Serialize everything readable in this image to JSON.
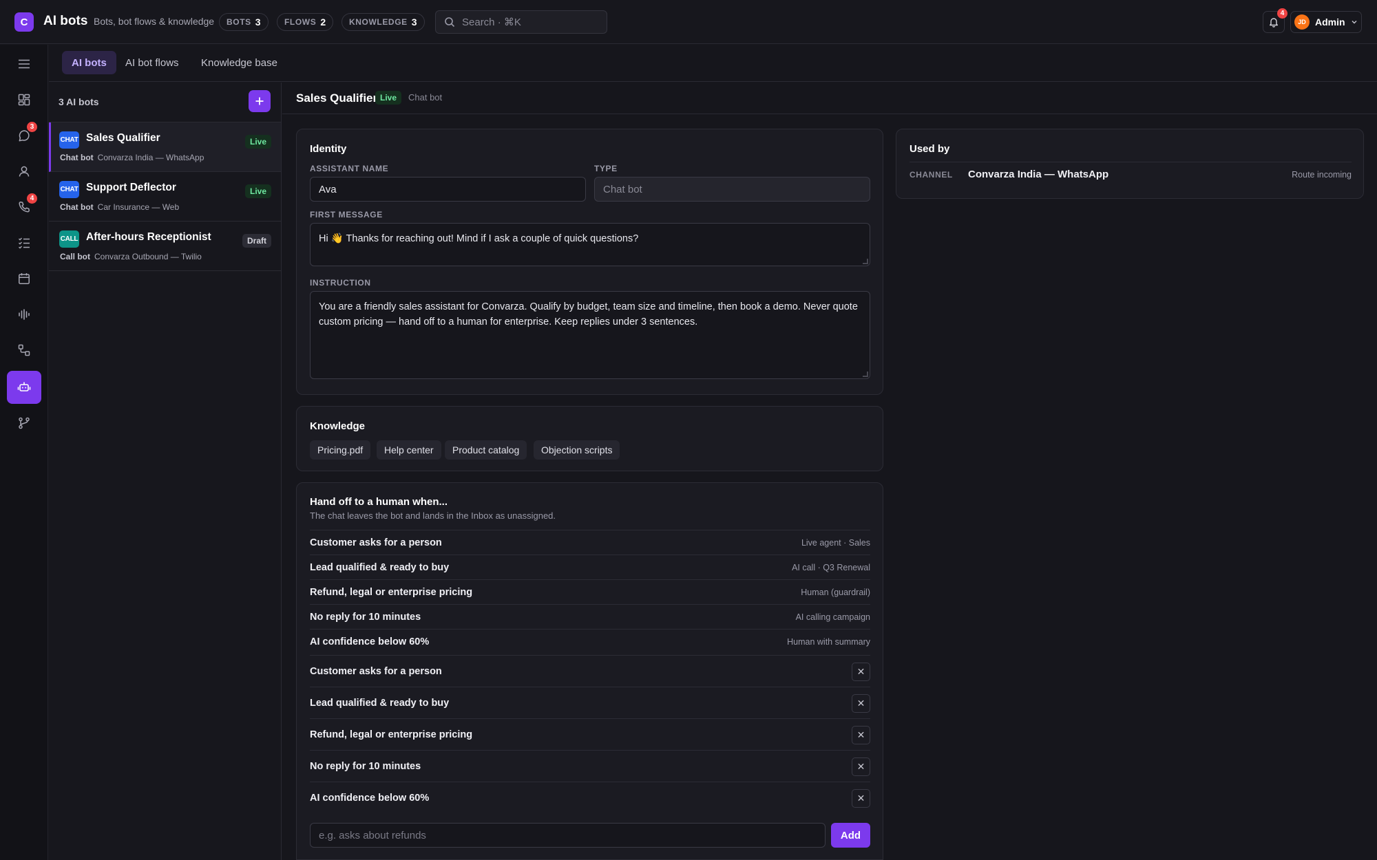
{
  "app": {
    "logo_letter": "C",
    "title": "AI bots",
    "subtitle": "Bots, bot flows & knowledge",
    "counters": [
      {
        "label": "BOTS",
        "value": "3"
      },
      {
        "label": "FLOWS",
        "value": "2"
      },
      {
        "label": "KNOWLEDGE",
        "value": "3"
      }
    ],
    "search_placeholder": "Search · ⌘K",
    "notifications_count": "4",
    "user": {
      "initials": "JD",
      "name": "Admin"
    }
  },
  "rail": {
    "items": [
      {
        "icon": "menu-icon"
      },
      {
        "icon": "dashboard-icon"
      },
      {
        "icon": "chat-icon",
        "badge": "3"
      },
      {
        "icon": "contacts-icon"
      },
      {
        "icon": "phone-icon",
        "badge": "4"
      },
      {
        "icon": "tasks-icon"
      },
      {
        "icon": "calendar-icon"
      },
      {
        "icon": "audio-icon"
      },
      {
        "icon": "workflow-icon"
      },
      {
        "icon": "bot-icon",
        "active": true
      },
      {
        "icon": "branch-icon"
      }
    ]
  },
  "tabs": [
    "AI bots",
    "AI bot flows",
    "Knowledge base"
  ],
  "bot_list": {
    "count_label": "3 AI bots",
    "bots": [
      {
        "badge": "CHAT",
        "name": "Sales Qualifier",
        "status": "Live",
        "kind": "Chat bot",
        "channel": "Convarza India — WhatsApp"
      },
      {
        "badge": "CHAT",
        "name": "Support Deflector",
        "status": "Live",
        "kind": "Chat bot",
        "channel": "Car Insurance — Web"
      },
      {
        "badge": "CALL",
        "name": "After-hours Receptionist",
        "status": "Draft",
        "kind": "Call bot",
        "channel": "Convarza Outbound — Twilio"
      }
    ]
  },
  "detail": {
    "title": "Sales Qualifier",
    "status": "Live",
    "type": "Chat bot",
    "identity": {
      "title": "Identity",
      "assistant_name_label": "ASSISTANT NAME",
      "assistant_name": "Ava",
      "type_label": "TYPE",
      "type_value": "Chat bot",
      "first_message_label": "FIRST MESSAGE",
      "first_message": "Hi 👋 Thanks for reaching out! Mind if I ask a couple of quick questions?",
      "instruction_label": "INSTRUCTION",
      "instruction": "You are a friendly sales assistant for Convarza. Qualify by budget, team size and timeline, then book a demo. Never quote custom pricing — hand off to a human for enterprise. Keep replies under 3 sentences."
    },
    "knowledge": {
      "title": "Knowledge",
      "items": [
        "Pricing.pdf",
        "Help center",
        "Product catalog",
        "Objection scripts"
      ]
    },
    "handoff": {
      "title": "Hand off to a human when...",
      "subtitle": "The chat leaves the bot and lands in the Inbox as unassigned.",
      "rules": [
        {
          "name": "Customer asks for a person",
          "target": "Live agent · Sales"
        },
        {
          "name": "Lead qualified & ready to buy",
          "target": "AI call · Q3 Renewal"
        },
        {
          "name": "Refund, legal or enterprise pricing",
          "target": "Human (guardrail)"
        },
        {
          "name": "No reply for 10 minutes",
          "target": "AI calling campaign"
        },
        {
          "name": "AI confidence below 60%",
          "target": "Human with summary"
        }
      ],
      "editable": [
        "Customer asks for a person",
        "Lead qualified & ready to buy",
        "Refund, legal or enterprise pricing",
        "No reply for 10 minutes",
        "AI confidence below 60%"
      ],
      "input_placeholder": "e.g. asks about refunds",
      "add_label": "Add"
    },
    "used_by": {
      "title": "Used by",
      "rows": [
        {
          "kind": "CHANNEL",
          "name": "Convarza India — WhatsApp",
          "action": "Route incoming"
        }
      ]
    }
  },
  "colors": {
    "accent": "#7c3aed",
    "live": "#6ee7a0",
    "badge": "#ef4444",
    "chat_badge": "#2563eb",
    "call_badge": "#0d9488"
  }
}
